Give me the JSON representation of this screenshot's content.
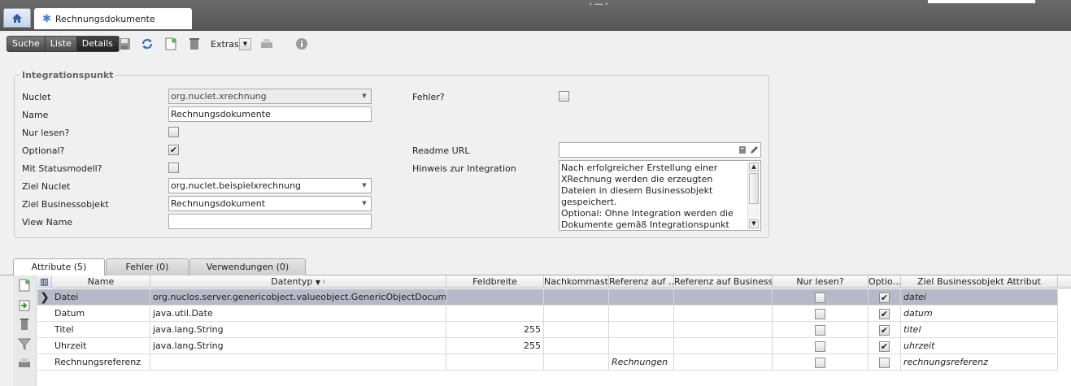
{
  "window": {
    "tab_title": "Rechnungsdokumente",
    "home_icon": "home-icon",
    "tab_icon": "gear-icon"
  },
  "toolbar": {
    "crumbs": [
      "Suche",
      "Liste",
      "Details"
    ],
    "extras_label": "Extras"
  },
  "panel": {
    "title": "Integrationspunkt",
    "nuclet_label": "Nuclet",
    "nuclet_value": "org.nuclet.xrechnung",
    "name_label": "Name",
    "name_value": "Rechnungsdokumente",
    "nur_lesen_label": "Nur lesen?",
    "nur_lesen_checked": false,
    "optional_label": "Optional?",
    "optional_checked": true,
    "statusmodell_label": "Mit Statusmodell?",
    "statusmodell_checked": false,
    "ziel_nuclet_label": "Ziel Nuclet",
    "ziel_nuclet_value": "org.nuclet.beispielxrechnung",
    "ziel_bo_label": "Ziel Businessobjekt",
    "ziel_bo_value": "Rechnungsdokument",
    "view_name_label": "View Name",
    "view_name_value": "",
    "fehler_label": "Fehler?",
    "fehler_checked": false,
    "readme_label": "Readme URL",
    "readme_value": "",
    "hinweis_label": "Hinweis zur Integration",
    "hinweis_value": "Nach erfolgreicher Erstellung einer XRechnung werden die erzeugten Dateien in diesem Businessobjekt gespeichert.\nOptional: Ohne Integration werden die Dokumente gemäß Integrationspunkt \"Dokumente (generalsearchdocument)\""
  },
  "tabs": [
    {
      "label": "Attribute (5)",
      "active": true
    },
    {
      "label": "Fehler (0)",
      "active": false
    },
    {
      "label": "Verwendungen (0)",
      "active": false
    }
  ],
  "grid": {
    "columns": [
      "Name",
      "Datentyp",
      "Feldbreite",
      "Nachkommast…",
      "Referenz auf …",
      "Referenz auf Business…",
      "Nur lesen?",
      "Optio…",
      "Ziel Businessobjekt Attribut"
    ],
    "sort_indicator": "▼ ¹",
    "rows": [
      {
        "name": "Datei",
        "datentyp": "org.nuclos.server.genericobject.valueobject.GenericObjectDocumentFile",
        "feldbreite": "",
        "nachkomma": "",
        "referenz": "",
        "referenz_bo": "",
        "nur_lesen": false,
        "optional": true,
        "ziel": "datei",
        "selected": true
      },
      {
        "name": "Datum",
        "datentyp": "java.util.Date",
        "feldbreite": "",
        "nachkomma": "",
        "referenz": "",
        "referenz_bo": "",
        "nur_lesen": false,
        "optional": true,
        "ziel": "datum",
        "selected": false
      },
      {
        "name": "Titel",
        "datentyp": "java.lang.String",
        "feldbreite": "255",
        "nachkomma": "",
        "referenz": "",
        "referenz_bo": "",
        "nur_lesen": false,
        "optional": true,
        "ziel": "titel",
        "selected": false
      },
      {
        "name": "Uhrzeit",
        "datentyp": "java.lang.String",
        "feldbreite": "255",
        "nachkomma": "",
        "referenz": "",
        "referenz_bo": "",
        "nur_lesen": false,
        "optional": true,
        "ziel": "uhrzeit",
        "selected": false
      },
      {
        "name": "Rechnungsreferenz",
        "datentyp": "",
        "feldbreite": "",
        "nachkomma": "",
        "referenz": "Rechnungen",
        "referenz_bo": "",
        "nur_lesen": false,
        "optional": false,
        "ziel": "rechnungsreferenz",
        "selected": false
      }
    ]
  },
  "colors": {
    "topbar": "#5f5f5f",
    "selected_row": "#b8b8c8",
    "accent": "#3a7bd5"
  }
}
